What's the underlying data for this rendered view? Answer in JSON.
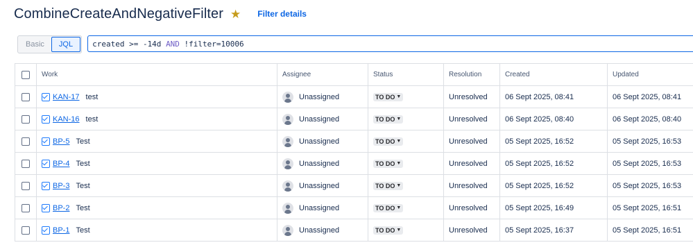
{
  "header": {
    "title": "CombineCreateAndNegativeFilter",
    "star_icon": "star-icon",
    "filter_details": "Filter details"
  },
  "query": {
    "modes": [
      "Basic",
      "JQL"
    ],
    "active_mode": "JQL",
    "jql_parts": {
      "p1": "created >= -14d ",
      "kw": "AND",
      "p2": " !filter=10006"
    }
  },
  "table": {
    "columns": [
      "Work",
      "Assignee",
      "Status",
      "Resolution",
      "Created",
      "Updated"
    ],
    "rows": [
      {
        "key": "KAN-17",
        "summary": "test",
        "assignee": "Unassigned",
        "status": "TO DO",
        "resolution": "Unresolved",
        "created": "06 Sept 2025, 08:41",
        "updated": "06 Sept 2025, 08:41"
      },
      {
        "key": "KAN-16",
        "summary": "test",
        "assignee": "Unassigned",
        "status": "TO DO",
        "resolution": "Unresolved",
        "created": "06 Sept 2025, 08:40",
        "updated": "06 Sept 2025, 08:40"
      },
      {
        "key": "BP-5",
        "summary": "Test",
        "assignee": "Unassigned",
        "status": "TO DO",
        "resolution": "Unresolved",
        "created": "05 Sept 2025, 16:52",
        "updated": "05 Sept 2025, 16:53"
      },
      {
        "key": "BP-4",
        "summary": "Test",
        "assignee": "Unassigned",
        "status": "TO DO",
        "resolution": "Unresolved",
        "created": "05 Sept 2025, 16:52",
        "updated": "05 Sept 2025, 16:53"
      },
      {
        "key": "BP-3",
        "summary": "Test",
        "assignee": "Unassigned",
        "status": "TO DO",
        "resolution": "Unresolved",
        "created": "05 Sept 2025, 16:52",
        "updated": "05 Sept 2025, 16:53"
      },
      {
        "key": "BP-2",
        "summary": "Test",
        "assignee": "Unassigned",
        "status": "TO DO",
        "resolution": "Unresolved",
        "created": "05 Sept 2025, 16:49",
        "updated": "05 Sept 2025, 16:51"
      },
      {
        "key": "BP-1",
        "summary": "Test",
        "assignee": "Unassigned",
        "status": "TO DO",
        "resolution": "Unresolved",
        "created": "05 Sept 2025, 16:37",
        "updated": "05 Sept 2025, 16:51"
      }
    ]
  },
  "colors": {
    "link": "#0c66e4",
    "star": "#c69c1c",
    "jql_keyword": "#6e5dc6"
  }
}
